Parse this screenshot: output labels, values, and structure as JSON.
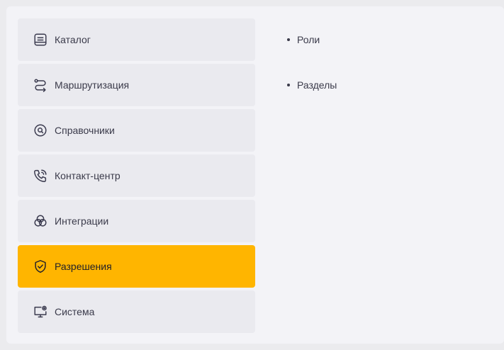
{
  "menu": {
    "items": [
      {
        "label": "Каталог",
        "icon": "catalog-icon",
        "active": false
      },
      {
        "label": "Маршрутизация",
        "icon": "routing-icon",
        "active": false
      },
      {
        "label": "Справочники",
        "icon": "search-circle-icon",
        "active": false
      },
      {
        "label": "Контакт-центр",
        "icon": "phone-call-icon",
        "active": false
      },
      {
        "label": "Интеграции",
        "icon": "integrations-icon",
        "active": false
      },
      {
        "label": "Разрешения",
        "icon": "shield-check-icon",
        "active": true
      },
      {
        "label": "Система",
        "icon": "monitor-gear-icon",
        "active": false
      }
    ]
  },
  "submenu": {
    "items": [
      {
        "label": "Роли"
      },
      {
        "label": "Разделы"
      }
    ]
  },
  "colors": {
    "active_bg": "#ffb500",
    "item_bg": "#eaeaef",
    "panel_bg": "#f3f3f7",
    "page_bg": "#ebebee",
    "text": "#3a3a4a"
  }
}
